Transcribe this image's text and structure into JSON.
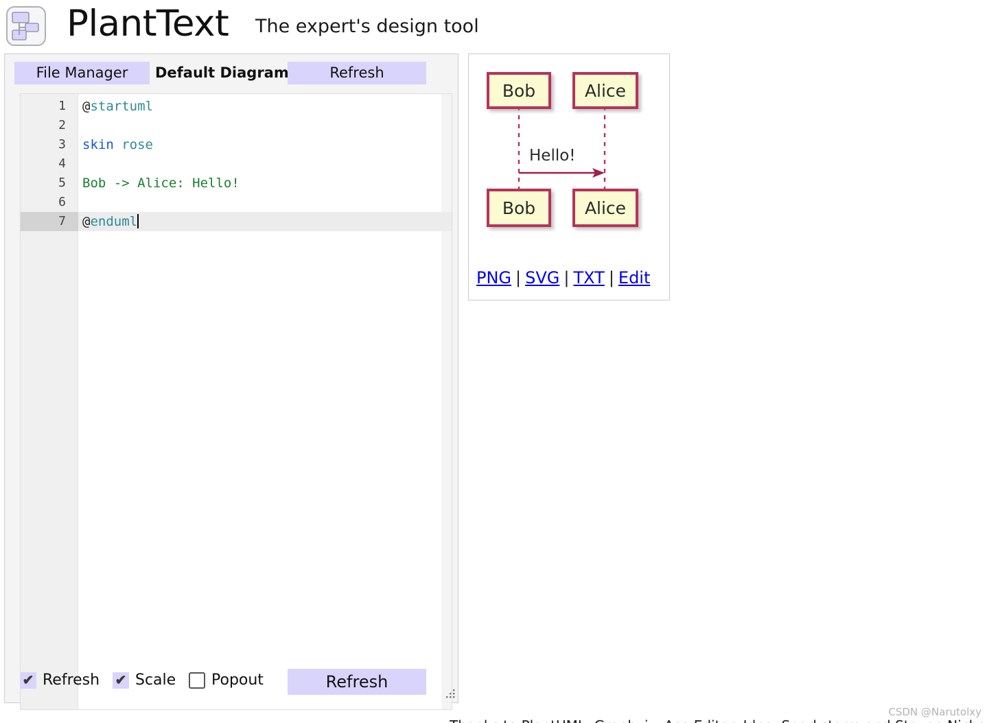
{
  "header": {
    "logo_icon": "diagram-blocks-icon",
    "brand": "PlantText",
    "tagline": "The expert's design tool"
  },
  "editor": {
    "tabs": [
      {
        "label": "File Manager",
        "active": false
      },
      {
        "label": "Default Diagram",
        "active": true
      },
      {
        "label": "Refresh",
        "active": false
      }
    ],
    "active_line": 7,
    "code_lines": [
      {
        "number": "1",
        "tokens": [
          {
            "text": "@",
            "cls": "tok-at"
          },
          {
            "text": "startuml",
            "cls": "tok-uml"
          }
        ]
      },
      {
        "number": "2",
        "tokens": []
      },
      {
        "number": "3",
        "tokens": [
          {
            "text": "skin",
            "cls": "tok-kw"
          },
          {
            "text": " ",
            "cls": ""
          },
          {
            "text": "rose",
            "cls": "tok-kw2"
          }
        ]
      },
      {
        "number": "4",
        "tokens": []
      },
      {
        "number": "5",
        "tokens": [
          {
            "text": "Bob -> Alice: Hello!",
            "cls": "tok-msg"
          }
        ]
      },
      {
        "number": "6",
        "tokens": []
      },
      {
        "number": "7",
        "tokens": [
          {
            "text": "@",
            "cls": "tok-at"
          },
          {
            "text": "enduml",
            "cls": "tok-uml"
          }
        ],
        "caret": true
      }
    ],
    "plain_code": "@startuml\n\nskin rose\n\nBob -> Alice: Hello!\n\n@enduml"
  },
  "controls": {
    "checkboxes": [
      {
        "label": "Refresh",
        "checked": true,
        "mark": "✔"
      },
      {
        "label": "Scale",
        "checked": true,
        "mark": "✔"
      },
      {
        "label": "Popout",
        "checked": false,
        "mark": ""
      }
    ],
    "refresh_button": "Refresh",
    "resize_grip_icon": "resize-grip-icon"
  },
  "diagram": {
    "type": "sequence",
    "participants": [
      "Bob",
      "Alice"
    ],
    "messages": [
      {
        "from": "Bob",
        "to": "Alice",
        "label": "Hello!",
        "arrow": "->"
      }
    ],
    "skin": "rose",
    "colors": {
      "box_fill": "#fbfbd2",
      "box_border": "#b8315a",
      "lifeline": "#b8315a",
      "arrow": "#a02048",
      "text": "#2b2b2b"
    },
    "links": [
      {
        "label": "PNG"
      },
      {
        "label": "SVG"
      },
      {
        "label": "TXT"
      },
      {
        "label": "Edit"
      }
    ],
    "link_separator": "|"
  },
  "watermark": "CSDN @Narutolxy",
  "page_footer": "Thanks to PlantUML, Graphviz, Ace Editor, Jdeo, Sparkstorm and Steven Nicholas @ C"
}
